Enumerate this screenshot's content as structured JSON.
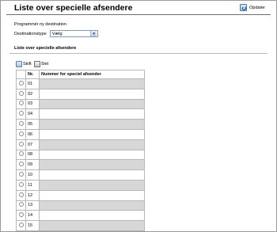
{
  "header": {
    "title": "Liste over specielle afsendere",
    "refresh_label": "Opdater"
  },
  "program": {
    "label": "Programmér ny destination",
    "desttype_label": "Destinationstype",
    "desttype_value": "Vælg"
  },
  "list": {
    "section_title": "Liste over specielle afsendere",
    "toolbar": {
      "edit_label": "Skift",
      "delete_label": "Slet"
    },
    "columns": {
      "nr": "Nr.",
      "number": "Nummer for speciel afsender"
    },
    "rows": [
      {
        "nr": "01",
        "number": ""
      },
      {
        "nr": "02",
        "number": ""
      },
      {
        "nr": "03",
        "number": ""
      },
      {
        "nr": "04",
        "number": ""
      },
      {
        "nr": "05",
        "number": ""
      },
      {
        "nr": "06",
        "number": ""
      },
      {
        "nr": "07",
        "number": ""
      },
      {
        "nr": "08",
        "number": ""
      },
      {
        "nr": "09",
        "number": ""
      },
      {
        "nr": "10",
        "number": ""
      },
      {
        "nr": "11",
        "number": ""
      },
      {
        "nr": "12",
        "number": ""
      },
      {
        "nr": "13",
        "number": ""
      },
      {
        "nr": "14",
        "number": ""
      },
      {
        "nr": "15",
        "number": ""
      }
    ]
  },
  "colors": {
    "row_alt": "#d7d7d7",
    "border": "#b8b8b8",
    "rule": "#6f6f6f"
  },
  "icons": {
    "refresh": "refresh-icon",
    "edit": "edit-icon",
    "delete": "delete-icon",
    "select": "chevron-down-icon"
  }
}
